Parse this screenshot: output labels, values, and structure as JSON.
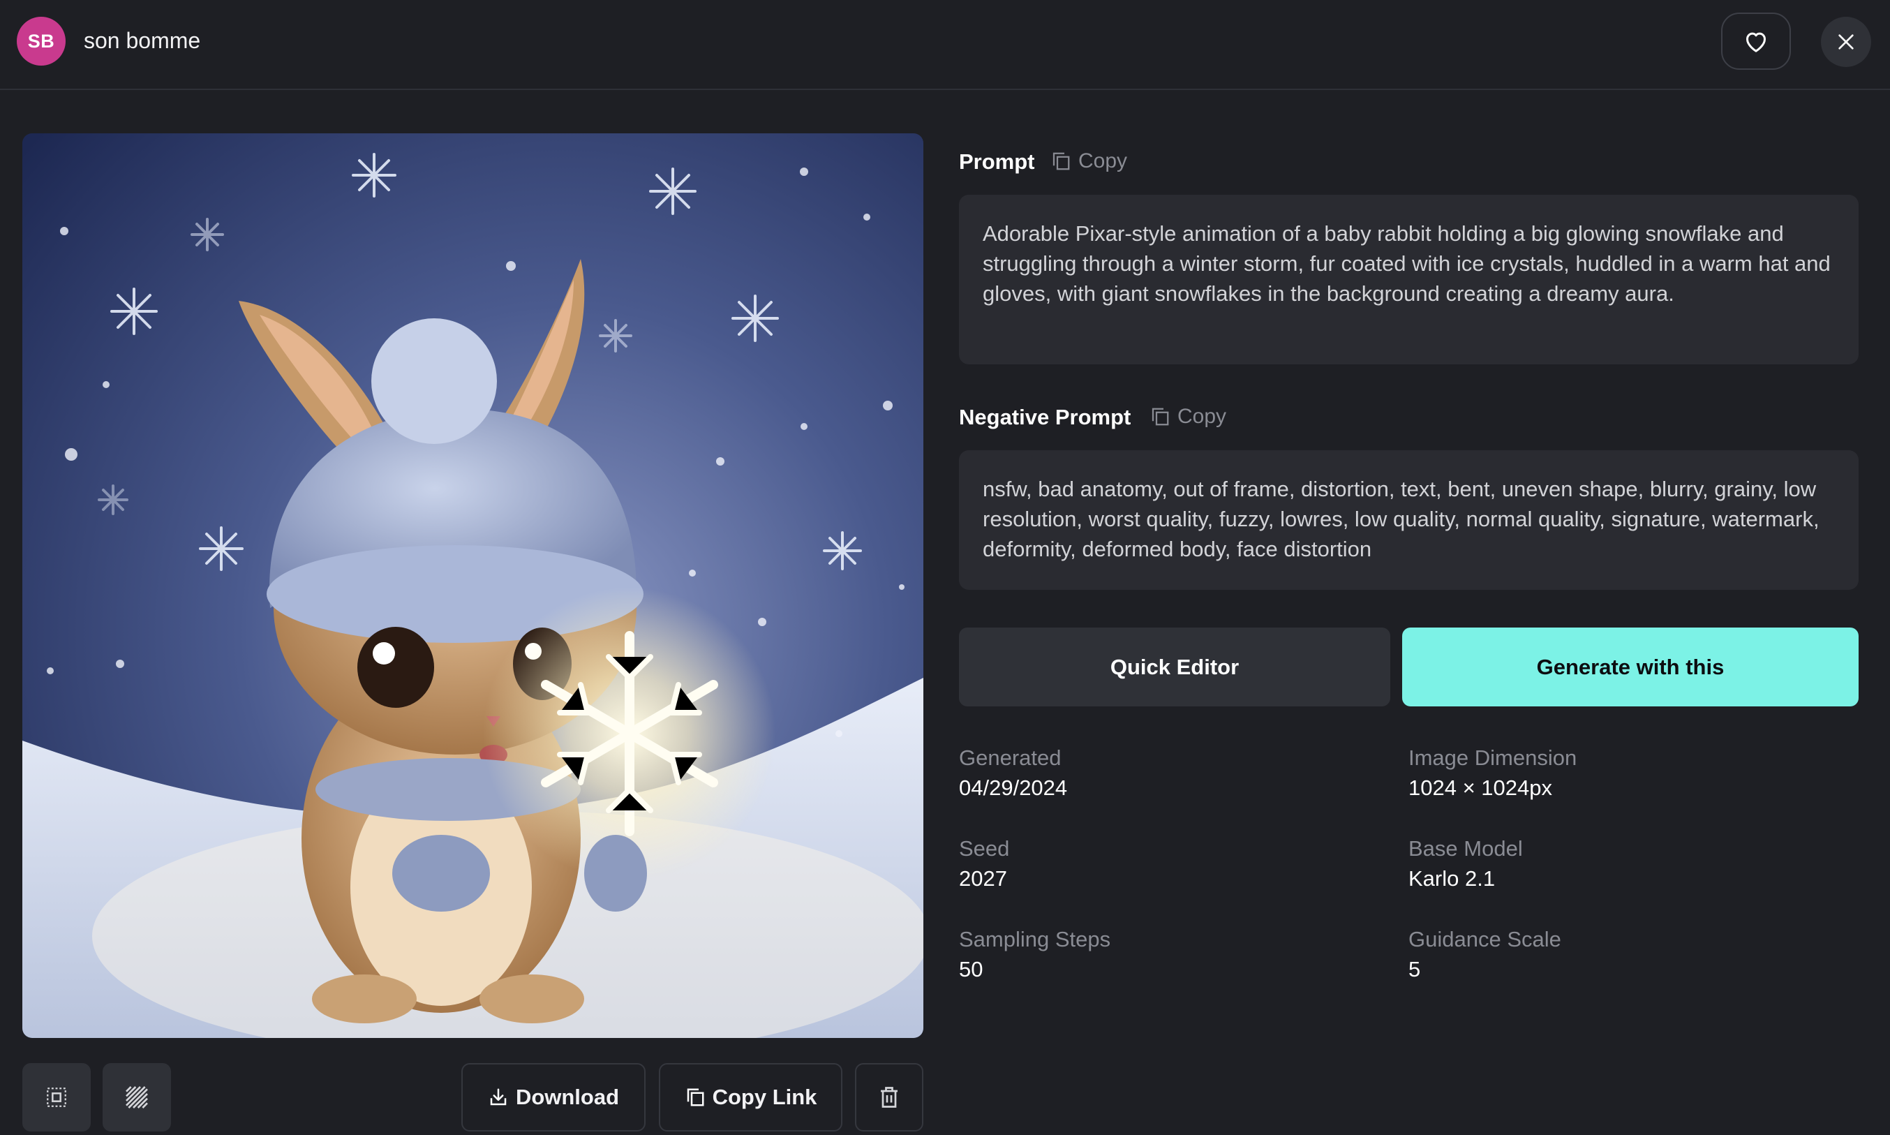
{
  "header": {
    "avatar_initials": "SB",
    "avatar_color": "#c93a8e",
    "username": "son bomme",
    "favorite_icon": "heart-icon",
    "close_icon": "close-icon"
  },
  "image": {
    "alt": "Baby rabbit in a knit hat holding a glowing snowflake in a snowy night"
  },
  "toolbar": {
    "download_label": "Download",
    "copy_link_label": "Copy Link",
    "fit_icon": "fit-screen-icon",
    "pattern_icon": "transparency-pattern-icon",
    "delete_icon": "trash-icon"
  },
  "prompt": {
    "title": "Prompt",
    "copy_label": "Copy",
    "text": "Adorable Pixar-style animation of a baby rabbit holding a big glowing snowflake and struggling through a winter storm, fur coated with ice crystals, huddled in a warm hat and gloves, with giant snowflakes in the background creating a dreamy aura."
  },
  "negative_prompt": {
    "title": "Negative Prompt",
    "copy_label": "Copy",
    "text": "nsfw, bad anatomy, out of frame, distortion, text, bent, uneven shape, blurry, grainy, low resolution, worst quality, fuzzy, lowres, low quality, normal quality, signature, watermark, deformity, deformed body, face distortion"
  },
  "actions": {
    "quick_editor_label": "Quick Editor",
    "generate_label": "Generate with this",
    "accent_color": "#7cf2e6"
  },
  "details": {
    "generated_label": "Generated",
    "generated_value": "04/29/2024",
    "dimension_label": "Image Dimension",
    "dimension_value": "1024 × 1024px",
    "seed_label": "Seed",
    "seed_value": "2027",
    "model_label": "Base Model",
    "model_value": "Karlo 2.1",
    "steps_label": "Sampling Steps",
    "steps_value": "50",
    "guidance_label": "Guidance Scale",
    "guidance_value": "5"
  }
}
